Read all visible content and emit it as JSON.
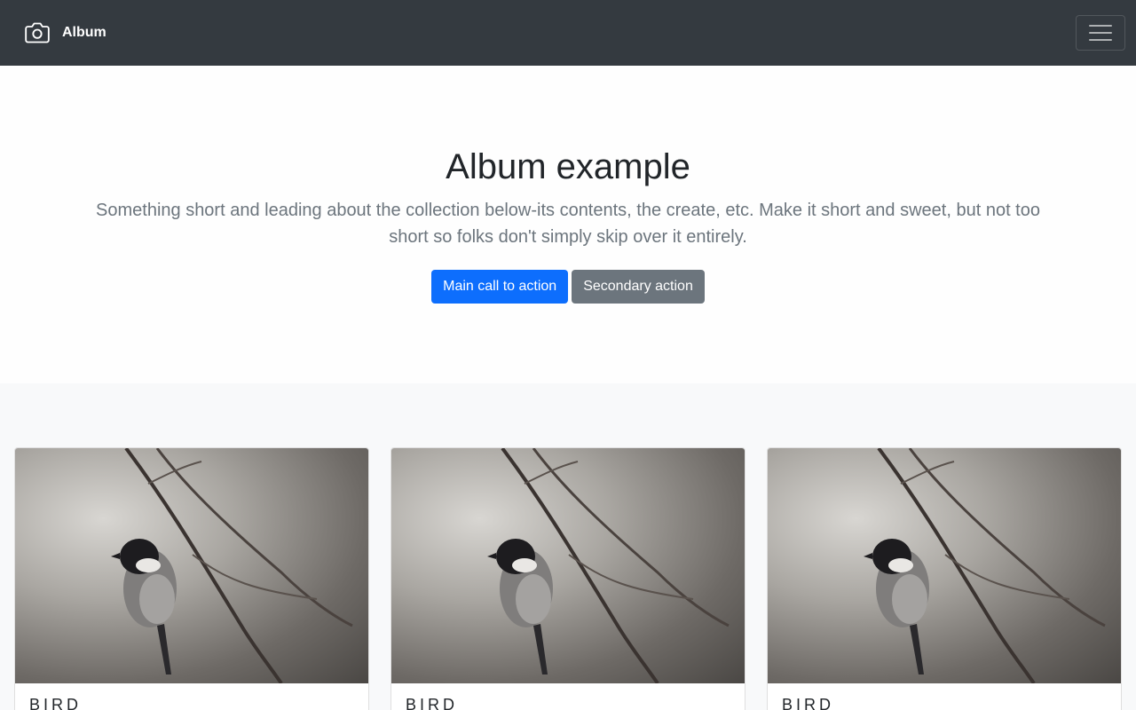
{
  "navbar": {
    "brand_label": "Album",
    "brand_icon": "camera-icon",
    "toggler_icon": "hamburger-icon"
  },
  "hero": {
    "title": "Album example",
    "lead": "Something short and leading about the collection below-its contents, the create, etc. Make it short and sweet, but not too short so folks don't simply skip over it entirely.",
    "primary_action": "Main call to action",
    "secondary_action": "Secondary action"
  },
  "album": {
    "cards": [
      {
        "title": "BIRD",
        "image": "bird-photo"
      },
      {
        "title": "BIRD",
        "image": "bird-photo"
      },
      {
        "title": "BIRD",
        "image": "bird-photo"
      }
    ]
  },
  "colors": {
    "navbar_bg": "#343a40",
    "primary": "#0d6efd",
    "secondary": "#6c757d",
    "album_bg": "#f8f9fa"
  }
}
